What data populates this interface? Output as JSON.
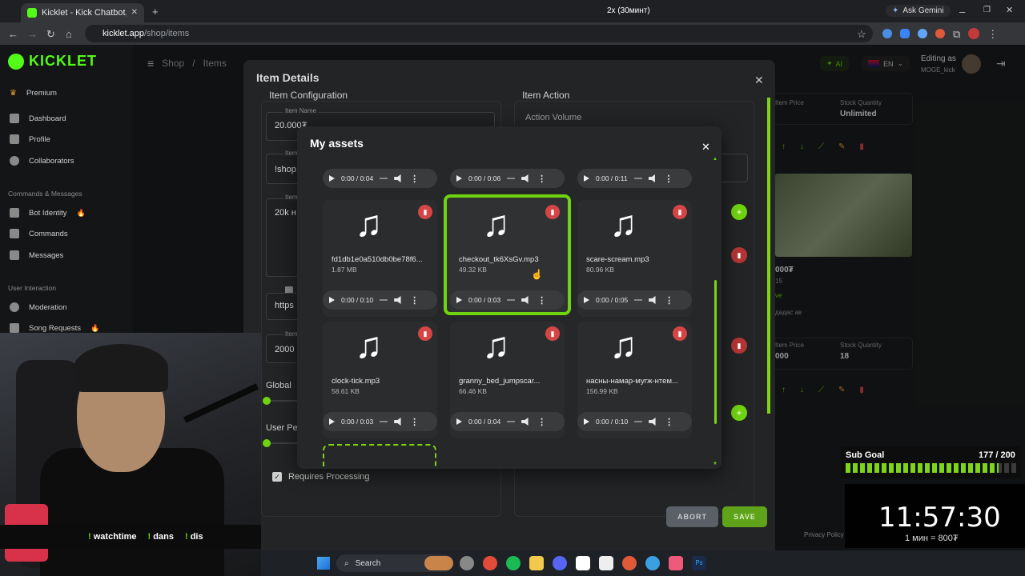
{
  "browser": {
    "tab_title": "Kicklet - Kick Chatbot, Kick Wi...",
    "speed_label": "2x (30минт)",
    "ask_gemini": "Ask Gemini",
    "url_host": "kicklet.app",
    "url_path": "/shop/items"
  },
  "sidebar": {
    "logo": "KICKLET",
    "items_top": [
      {
        "label": "Premium"
      },
      {
        "label": "Dashboard"
      },
      {
        "label": "Profile"
      },
      {
        "label": "Collaborators"
      }
    ],
    "section_commands": "Commands & Messages",
    "items_commands": [
      {
        "label": "Bot Identity"
      },
      {
        "label": "Commands"
      },
      {
        "label": "Messages"
      }
    ],
    "section_interaction": "User Interaction",
    "items_interaction": [
      {
        "label": "Moderation"
      },
      {
        "label": "Song Requests"
      }
    ]
  },
  "header": {
    "breadcrumb_shop": "Shop",
    "breadcrumb_sep": "/",
    "breadcrumb_items": "Items",
    "ai_label": "AI",
    "lang": "EN",
    "editing_as": "Editing as",
    "username": "MOGE_kick"
  },
  "item_details": {
    "title": "Item Details",
    "config_title": "Item Configuration",
    "action_title": "Item Action",
    "action_volume": "Action Volume",
    "item_name_label": "Item Name",
    "item_name_value": "20.000₮",
    "field2_label": "Item",
    "field2_value": "!shop",
    "field3_label": "Item",
    "field3_value": "20k н",
    "field4_value": "https",
    "field5_label": "Item",
    "field5_value": "2000",
    "global_label": "Global",
    "user_label": "User Pe",
    "requires_processing": "Requires Processing",
    "abort": "ABORT",
    "save": "SAVE",
    "privacy": "Privacy Policy"
  },
  "assets": {
    "title": "My assets",
    "top_row_players": [
      {
        "time": "0:00 / 0:04"
      },
      {
        "time": "0:00 / 0:06"
      },
      {
        "time": "0:00 / 0:11"
      }
    ],
    "cards": [
      {
        "name": "fd1db1e0a510db0be78f6...",
        "size": "1.87 MB",
        "time": "0:00 / 0:10",
        "selected": false
      },
      {
        "name": "checkout_tk6XsGv.mp3",
        "size": "49.32 KB",
        "time": "0:00 / 0:03",
        "selected": true
      },
      {
        "name": "scare-scream.mp3",
        "size": "80.96 KB",
        "time": "0:00 / 0:05",
        "selected": false
      },
      {
        "name": "clock-tick.mp3",
        "size": "58.61 KB",
        "time": "0:00 / 0:03",
        "selected": false
      },
      {
        "name": "granny_bed_jumpscar...",
        "size": "66.46 KB",
        "time": "0:00 / 0:04",
        "selected": false
      },
      {
        "name": "насны-намар-мугж-нтем...",
        "size": "156.99 KB",
        "time": "0:00 / 0:10",
        "selected": false
      }
    ]
  },
  "right_panel": {
    "item_price_label": "Item Price",
    "stock_label": "Stock Quantity",
    "stock_value_1": "Unlimited",
    "price_value_2": "000₮",
    "sub_text_1": "15",
    "sub_text_2": "ve",
    "sub_text_3": "дадас ав",
    "item_price_label_2": "Item Price",
    "price_value_3": "000",
    "stock_label_2": "Stock Quantity",
    "stock_value_2": "18"
  },
  "stream_overlay": {
    "ticker": [
      "watchtime",
      "dans",
      "dis"
    ],
    "sub_goal_label": "Sub Goal",
    "sub_goal_progress": "177 / 200",
    "sub_goal_fraction": 0.885,
    "timer": "11:57:30",
    "timer_rate": "1 мин = 800₮"
  },
  "taskbar": {
    "search": "Search"
  },
  "colors": {
    "accent": "#53fc18",
    "selected_border": "#6fd40f",
    "delete": "#d64545"
  }
}
